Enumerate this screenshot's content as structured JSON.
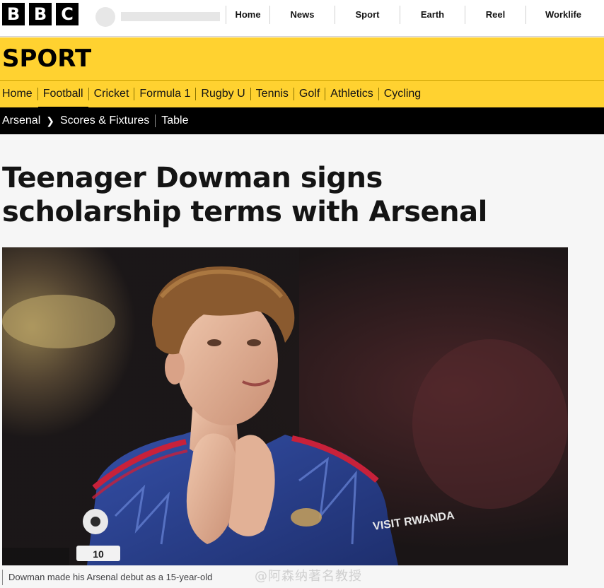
{
  "brand": {
    "letters": [
      "B",
      "B",
      "C"
    ]
  },
  "topnav": {
    "items": [
      "Home",
      "News",
      "Sport",
      "Earth",
      "Reel",
      "Worklife"
    ]
  },
  "sport": {
    "title": "SPORT"
  },
  "sport_nav": {
    "items": [
      "Home",
      "Football",
      "Cricket",
      "Formula 1",
      "Rugby U",
      "Tennis",
      "Golf",
      "Athletics",
      "Cycling"
    ],
    "active": "Football"
  },
  "breadcrumb": {
    "team": "Arsenal",
    "scores": "Scores & Fixtures",
    "table": "Table"
  },
  "article": {
    "headline": "Teenager Dowman signs scholarship terms with Arsenal",
    "caption": "Dowman made his Arsenal debut as a 15-year-old",
    "hero_sponsor_text": "VISIT RWANDA",
    "badge_text": "10"
  },
  "watermark": "@阿森纳著名教授",
  "colors": {
    "sport_yellow": "#ffd230",
    "black": "#000000",
    "kit_blue": "#2a3f86",
    "kit_red": "#c8213a"
  }
}
